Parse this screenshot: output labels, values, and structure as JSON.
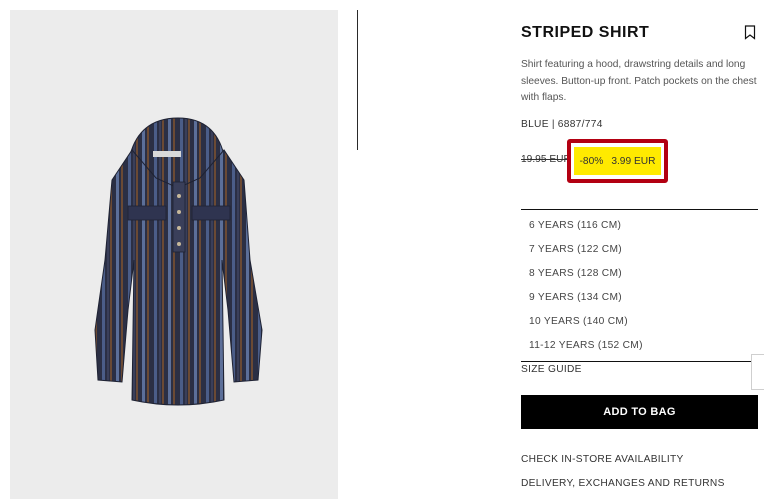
{
  "product": {
    "title": "STRIPED SHIRT",
    "description": "Shirt featuring a hood, drawstring details and long sleeves. Button-up front. Patch pockets on the chest with flaps.",
    "color": "BLUE",
    "reference": "6887/774",
    "old_price": "19.95 EUR",
    "discount": "-80%",
    "new_price": "3.99 EUR"
  },
  "sizes": [
    "6 YEARS (116 CM)",
    "7 YEARS (122 CM)",
    "8 YEARS (128 CM)",
    "9 YEARS (134 CM)",
    "10 YEARS (140 CM)",
    "11-12 YEARS (152 CM)"
  ],
  "actions": {
    "size_guide": "SIZE GUIDE",
    "add_to_bag": "ADD TO BAG",
    "check_availability": "CHECK IN-STORE AVAILABILITY",
    "delivery": "DELIVERY, EXCHANGES AND RETURNS"
  },
  "icons": {
    "bookmark": "bookmark-icon"
  },
  "colors": {
    "highlight_border": "#b30012",
    "highlight_fill": "#ffea00",
    "button_bg": "#000000",
    "image_bg": "#ececec"
  }
}
